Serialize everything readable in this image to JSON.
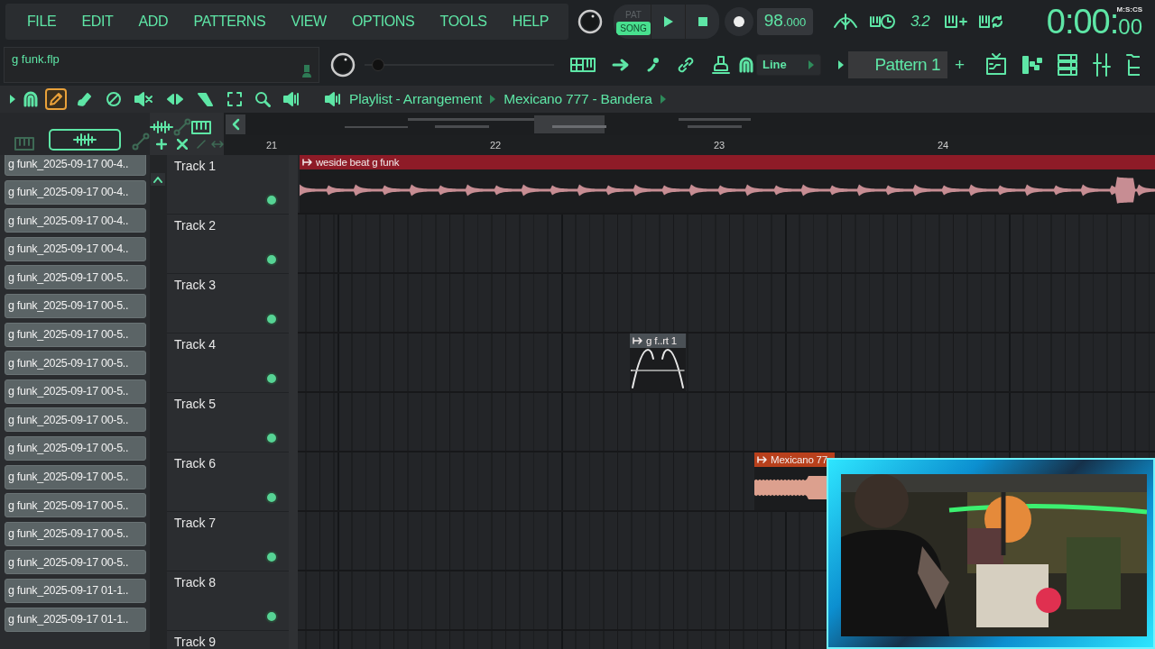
{
  "menu": [
    "FILE",
    "EDIT",
    "ADD",
    "PATTERNS",
    "VIEW",
    "OPTIONS",
    "TOOLS",
    "HELP"
  ],
  "transport": {
    "modes": [
      {
        "label": "PAT",
        "selected": false
      },
      {
        "label": "SONG",
        "selected": true
      }
    ],
    "tempo": "98",
    "tempo_fraction": ".000",
    "snap": "3.2",
    "time_format": "M:S:CS",
    "time": "0:00:",
    "time_cs": "00"
  },
  "project": {
    "filename": "g funk.flp",
    "pitch_slider": {
      "level": 0.04
    }
  },
  "toolbar": {
    "tool_mode": "Line",
    "pattern": "Pattern 1",
    "add_pattern": "+"
  },
  "playlist": {
    "tools": [
      {
        "kind": "pencil",
        "selected": true
      },
      {
        "kind": "paint",
        "selected": false
      },
      {
        "kind": "delete",
        "selected": false
      },
      {
        "kind": "mute",
        "selected": false
      },
      {
        "kind": "slip",
        "selected": false
      },
      {
        "kind": "slice",
        "selected": false
      },
      {
        "kind": "select",
        "selected": false
      },
      {
        "kind": "zoom",
        "selected": false
      },
      {
        "kind": "playback",
        "selected": false
      }
    ],
    "title": "Playlist - Arrangement",
    "arrangement": "Mexicano 777 - Bandera",
    "bars": [
      "21",
      "22",
      "23",
      "24"
    ],
    "tracks": [
      {
        "name": "Track 1",
        "enabled": true,
        "clips": [
          {
            "kind": "audio",
            "label": "weside beat g funk",
            "color": "#8e1b27"
          }
        ]
      },
      {
        "name": "Track 2",
        "enabled": true
      },
      {
        "name": "Track 3",
        "enabled": true
      },
      {
        "name": "Track 4",
        "enabled": true,
        "clips": [
          {
            "kind": "automation",
            "label": "g f..rt 1",
            "color": "#4a5055"
          }
        ]
      },
      {
        "name": "Track 5",
        "enabled": true
      },
      {
        "name": "Track 6",
        "enabled": true,
        "clips": [
          {
            "kind": "audio",
            "label": "Mexicano 77",
            "color": "#b8401c"
          }
        ]
      },
      {
        "name": "Track 7",
        "enabled": true
      },
      {
        "name": "Track 8",
        "enabled": true
      },
      {
        "name": "Track 9"
      }
    ]
  },
  "browser": {
    "items": [
      "g funk_2025-09-17 00-4..",
      "g funk_2025-09-17 00-4..",
      "g funk_2025-09-17 00-4..",
      "g funk_2025-09-17 00-4..",
      "g funk_2025-09-17 00-5..",
      "g funk_2025-09-17 00-5..",
      "g funk_2025-09-17 00-5..",
      "g funk_2025-09-17 00-5..",
      "g funk_2025-09-17 00-5..",
      "g funk_2025-09-17 00-5..",
      "g funk_2025-09-17 00-5..",
      "g funk_2025-09-17 00-5..",
      "g funk_2025-09-17 00-5..",
      "g funk_2025-09-17 00-5..",
      "g funk_2025-09-17 00-5..",
      "g funk_2025-09-17 01-1..",
      "g funk_2025-09-17 01-1.."
    ]
  }
}
